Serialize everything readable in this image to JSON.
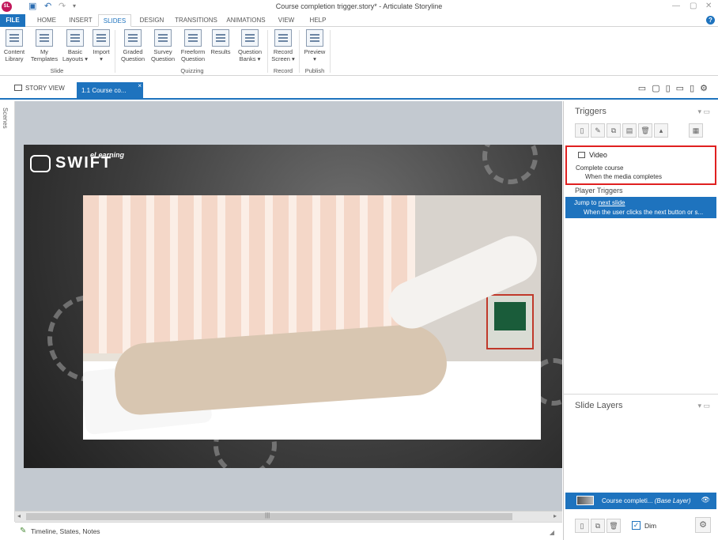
{
  "titlebar": {
    "app_badge": "SL",
    "title": "Course completion trigger.story* - Articulate Storyline",
    "qa_icons": [
      "save-icon",
      "undo-icon",
      "redo-icon",
      "customize-icon"
    ]
  },
  "ribbon_tabs": [
    "FILE",
    "HOME",
    "INSERT",
    "SLIDES",
    "DESIGN",
    "TRANSITIONS",
    "ANIMATIONS",
    "VIEW",
    "HELP"
  ],
  "ribbon": {
    "slide_group": {
      "label": "Slide",
      "buttons": [
        "Content\nLibrary",
        "My\nTemplates",
        "Basic\nLayouts ▾",
        "Import\n▾"
      ]
    },
    "quizzing_group": {
      "label": "Quizzing",
      "buttons": [
        "Graded\nQuestion",
        "Survey\nQuestion",
        "Freeform\nQuestion",
        "Results",
        "Question\nBanks ▾"
      ]
    },
    "record_group": {
      "label": "Record",
      "buttons": [
        "Record\nScreen ▾"
      ]
    },
    "publish_group": {
      "label": "Publish",
      "buttons": [
        "Preview\n▾"
      ]
    }
  },
  "doc_tabs": {
    "story_view": "STORY VIEW",
    "slide_tab": "1.1 Course co...",
    "close": "×"
  },
  "scenes_label": "Scenes",
  "slide": {
    "logo_text": "SWIFT",
    "logo_sub": "eLearning"
  },
  "statusbar": {
    "label": "Timeline, States, Notes"
  },
  "triggers_panel": {
    "title": "Triggers",
    "object_name": "Video",
    "trigger_action": "Complete course",
    "trigger_condition": "When the media completes",
    "player_triggers_title": "Player Triggers",
    "player_trigger_action": "Jump to",
    "player_trigger_target": "next slide",
    "player_trigger_condition": "When the user clicks the next button or s..."
  },
  "layers_panel": {
    "title": "Slide Layers",
    "base_layer_name": "Course completi...",
    "base_layer_tag": "(Base Layer)",
    "dim_label": "Dim",
    "dim_checked": true
  },
  "colors": {
    "accent": "#1e73be",
    "highlight_border": "#e02020"
  }
}
